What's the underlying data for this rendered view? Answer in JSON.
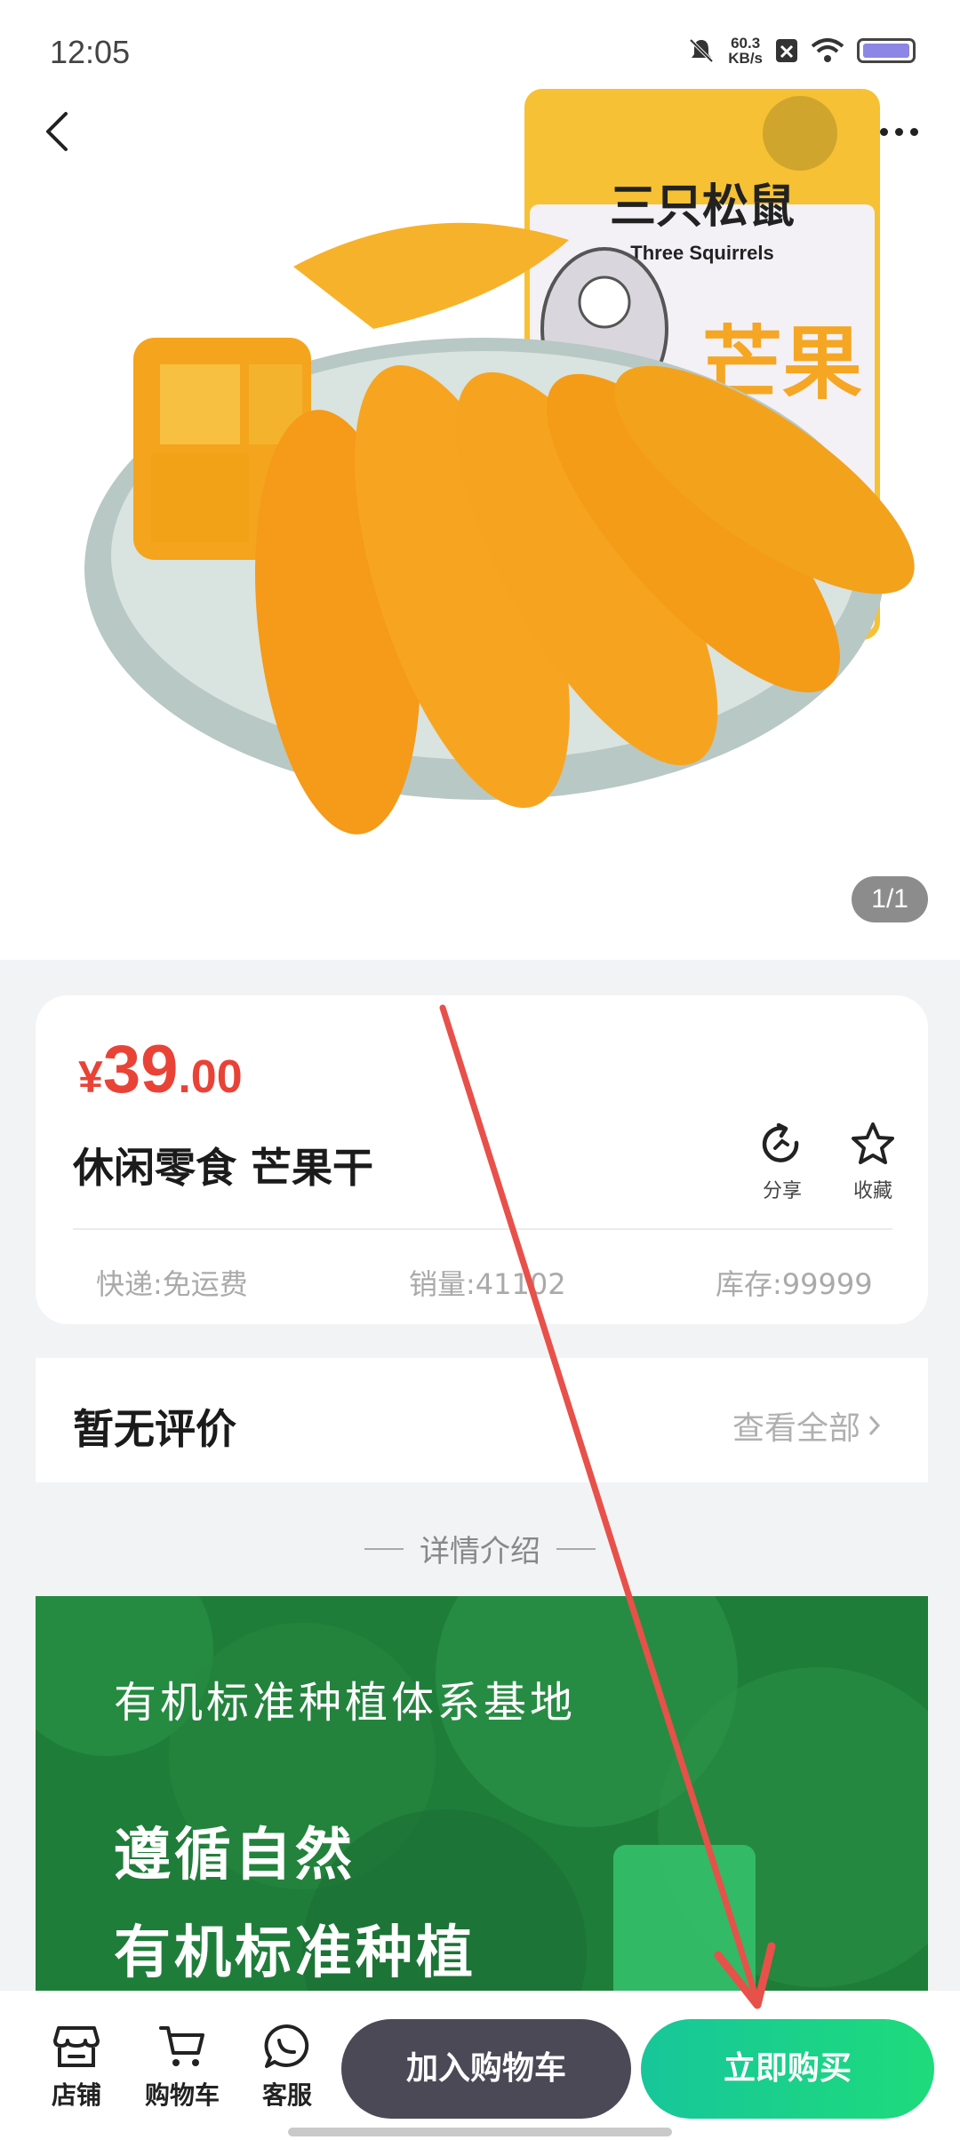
{
  "status_bar": {
    "time": "12:05",
    "net_speed_value": "60.3",
    "net_speed_unit": "KB/s"
  },
  "hero": {
    "page_indicator": "1/1",
    "package_brand": "三只松鼠",
    "package_brand_en": "Three Squirrels",
    "package_text": "芒果"
  },
  "product": {
    "price_symbol": "¥",
    "price_int": "39",
    "price_dec": ".00",
    "title": "休闲零食 芒果干",
    "share_label": "分享",
    "favorite_label": "收藏",
    "shipping": "快递:免运费",
    "sales": "销量:41102",
    "stock": "库存:99999"
  },
  "reviews": {
    "title": "暂无评价",
    "view_all": "查看全部"
  },
  "details": {
    "heading": "详情介绍",
    "banner_line1": "有机标准种植体系基地",
    "banner_line2": "遵循自然",
    "banner_line3": "有机标准种植"
  },
  "bottom_bar": {
    "shop_label": "店铺",
    "cart_label": "购物车",
    "service_label": "客服",
    "add_to_cart": "加入购物车",
    "buy_now": "立即购买"
  },
  "colors": {
    "price": "#e94337",
    "buy_button": "#1edb7b",
    "cart_button": "#4b4956",
    "annotation_arrow": "#e8504a"
  }
}
